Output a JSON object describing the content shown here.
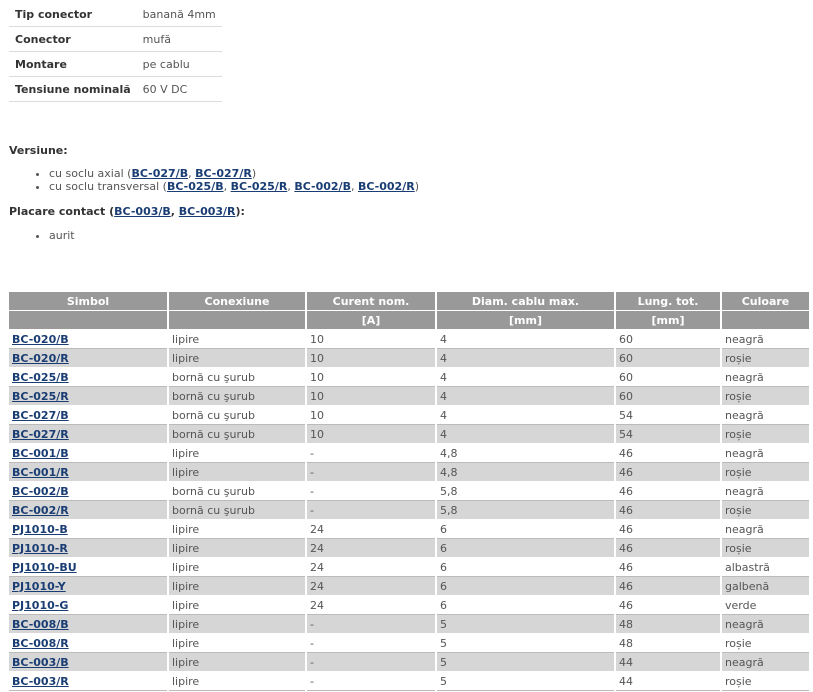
{
  "specs": [
    {
      "key": "Tip conector",
      "value": "banană 4mm"
    },
    {
      "key": "Conector",
      "value": "mufă"
    },
    {
      "key": "Montare",
      "value": "pe cablu"
    },
    {
      "key": "Tensiune nominală",
      "value": "60 V DC"
    }
  ],
  "versions": {
    "title": "Versiune:",
    "axial": {
      "prefix": "cu soclu axial (",
      "links": [
        "BC-027/B",
        "BC-027/R"
      ],
      "suffix": ")"
    },
    "transversal": {
      "prefix": "cu soclu transversal (",
      "links": [
        "BC-025/B",
        "BC-025/R",
        "BC-002/B",
        "BC-002/R"
      ],
      "suffix": ")"
    }
  },
  "plating": {
    "prefix": "Placare contact (",
    "links": [
      "BC-003/B",
      "BC-003/R"
    ],
    "suffix": "):",
    "items": [
      "aurit"
    ]
  },
  "table": {
    "headers": [
      "Simbol",
      "Conexiune",
      "Curent nom.",
      "Diam. cablu max.",
      "Lung. tot.",
      "Culoare"
    ],
    "units": [
      "",
      "",
      "[A]",
      "[mm]",
      "[mm]",
      ""
    ],
    "rows": [
      [
        "BC-020/B",
        "lipire",
        "10",
        "4",
        "60",
        "neagră"
      ],
      [
        "BC-020/R",
        "lipire",
        "10",
        "4",
        "60",
        "roșie"
      ],
      [
        "BC-025/B",
        "bornă cu şurub",
        "10",
        "4",
        "60",
        "neagră"
      ],
      [
        "BC-025/R",
        "bornă cu şurub",
        "10",
        "4",
        "60",
        "roșie"
      ],
      [
        "BC-027/B",
        "bornă cu şurub",
        "10",
        "4",
        "54",
        "neagră"
      ],
      [
        "BC-027/R",
        "bornă cu şurub",
        "10",
        "4",
        "54",
        "roșie"
      ],
      [
        "BC-001/B",
        "lipire",
        "-",
        "4,8",
        "46",
        "neagră"
      ],
      [
        "BC-001/R",
        "lipire",
        "-",
        "4,8",
        "46",
        "roșie"
      ],
      [
        "BC-002/B",
        "bornă cu şurub",
        "-",
        "5,8",
        "46",
        "neagră"
      ],
      [
        "BC-002/R",
        "bornă cu şurub",
        "-",
        "5,8",
        "46",
        "roșie"
      ],
      [
        "PJ1010-B",
        "lipire",
        "24",
        "6",
        "46",
        "neagră"
      ],
      [
        "PJ1010-R",
        "lipire",
        "24",
        "6",
        "46",
        "roșie"
      ],
      [
        "PJ1010-BU",
        "lipire",
        "24",
        "6",
        "46",
        "albastră"
      ],
      [
        "PJ1010-Y",
        "lipire",
        "24",
        "6",
        "46",
        "galbenă"
      ],
      [
        "PJ1010-G",
        "lipire",
        "24",
        "6",
        "46",
        "verde"
      ],
      [
        "BC-008/B",
        "lipire",
        "-",
        "5",
        "48",
        "neagră"
      ],
      [
        "BC-008/R",
        "lipire",
        "-",
        "5",
        "48",
        "roșie"
      ],
      [
        "BC-003/B",
        "lipire",
        "-",
        "5",
        "44",
        "neagră"
      ],
      [
        "BC-003/R",
        "lipire",
        "-",
        "5",
        "44",
        "roșie"
      ]
    ]
  }
}
